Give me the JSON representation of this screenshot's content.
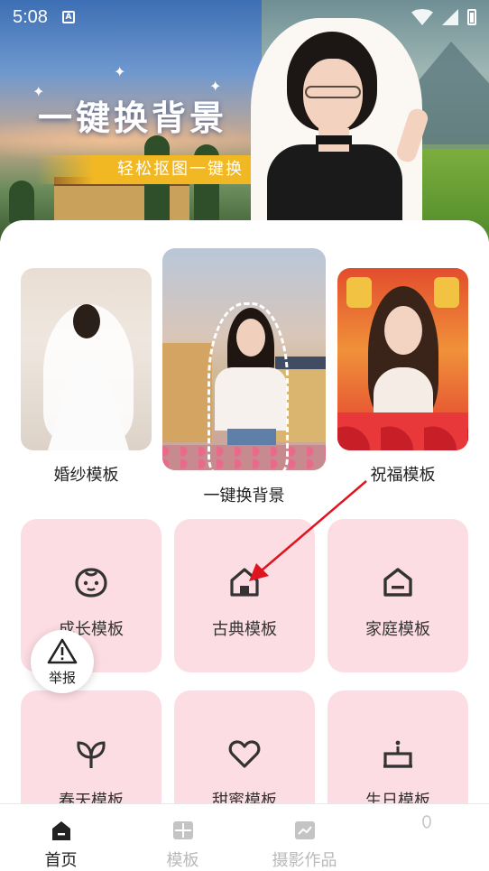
{
  "status_bar": {
    "time": "5:08",
    "notification_badge": "A"
  },
  "banner": {
    "title": "一键换背景",
    "subtitle": "轻松抠图一键换"
  },
  "feature_cards": [
    {
      "label": "婚纱模板"
    },
    {
      "label": "一键换背景"
    },
    {
      "label": "祝福模板"
    }
  ],
  "grid": [
    {
      "label": "成长模板",
      "icon": "baby-face-icon"
    },
    {
      "label": "古典模板",
      "icon": "classical-house-icon"
    },
    {
      "label": "家庭模板",
      "icon": "home-icon"
    },
    {
      "label": "春天模板",
      "icon": "leaf-icon"
    },
    {
      "label": "甜蜜模板",
      "icon": "heart-icon"
    },
    {
      "label": "生日模板",
      "icon": "birthday-cake-icon"
    }
  ],
  "report_button": {
    "label": "举报",
    "icon": "warning-icon"
  },
  "bottom_nav": [
    {
      "label": "首页",
      "icon": "home-icon",
      "active": true
    },
    {
      "label": "模板",
      "icon": "template-icon",
      "active": false
    },
    {
      "label": "摄影作品",
      "icon": "photo-icon",
      "active": false
    },
    {
      "label": "",
      "icon": "profile-icon",
      "active": false
    }
  ],
  "colors": {
    "tile_background": "#fcdde3",
    "banner_accent": "#f2b824",
    "annotation_arrow": "#e0141e",
    "nav_inactive": "#b9b9b9"
  }
}
